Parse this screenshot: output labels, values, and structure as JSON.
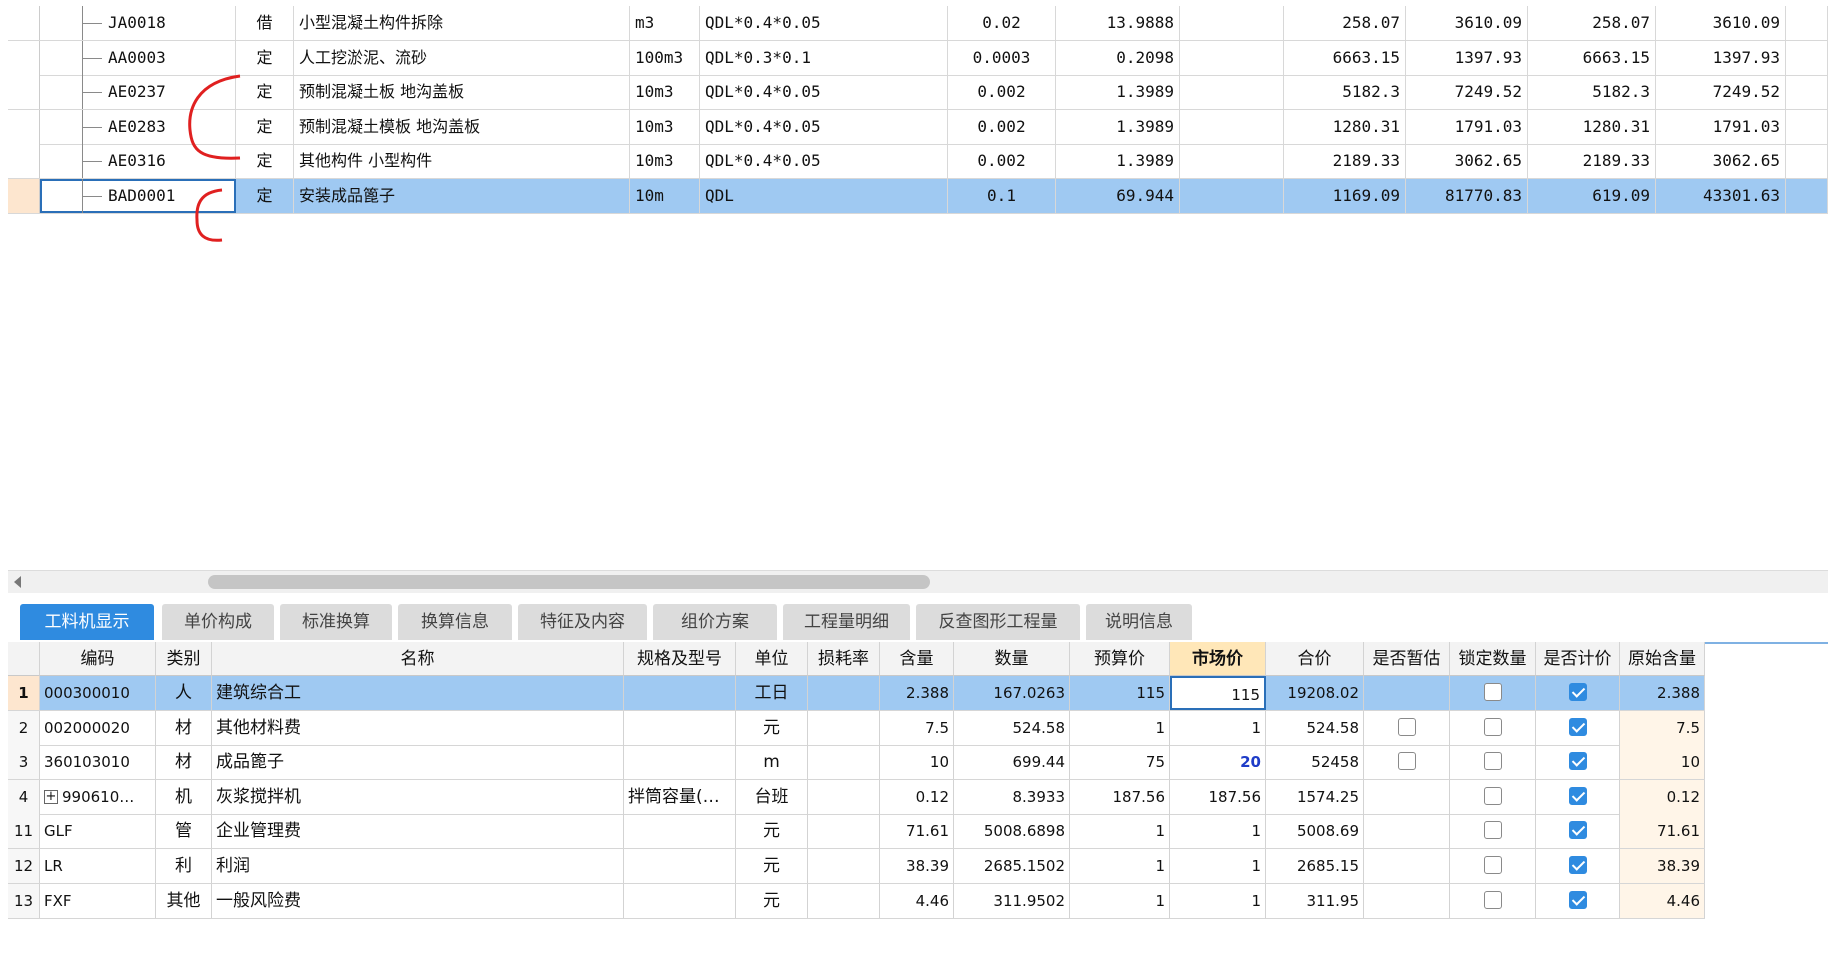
{
  "upper_rows": [
    {
      "code": "JA0018",
      "type": "借",
      "name": "小型混凝土构件拆除",
      "unit": "m3",
      "expr": "QDL*0.4*0.05",
      "coef": "0.02",
      "qty": "13.9888",
      "p1": "258.07",
      "p2": "3610.09",
      "p3": "258.07",
      "p4": "3610.09",
      "selected": false
    },
    {
      "code": "AA0003",
      "type": "定",
      "name": "人工挖淤泥、流砂",
      "unit": "100m3",
      "expr": "QDL*0.3*0.1",
      "coef": "0.0003",
      "qty": "0.2098",
      "p1": "6663.15",
      "p2": "1397.93",
      "p3": "6663.15",
      "p4": "1397.93",
      "selected": false
    },
    {
      "code": "AE0237",
      "type": "定",
      "name": "预制混凝土板 地沟盖板",
      "unit": "10m3",
      "expr": "QDL*0.4*0.05",
      "coef": "0.002",
      "qty": "1.3989",
      "p1": "5182.3",
      "p2": "7249.52",
      "p3": "5182.3",
      "p4": "7249.52",
      "selected": false
    },
    {
      "code": "AE0283",
      "type": "定",
      "name": "预制混凝土模板 地沟盖板",
      "unit": "10m3",
      "expr": "QDL*0.4*0.05",
      "coef": "0.002",
      "qty": "1.3989",
      "p1": "1280.31",
      "p2": "1791.03",
      "p3": "1280.31",
      "p4": "1791.03",
      "selected": false
    },
    {
      "code": "AE0316",
      "type": "定",
      "name": "其他构件 小型构件",
      "unit": "10m3",
      "expr": "QDL*0.4*0.05",
      "coef": "0.002",
      "qty": "1.3989",
      "p1": "2189.33",
      "p2": "3062.65",
      "p3": "2189.33",
      "p4": "3062.65",
      "selected": false
    },
    {
      "code": "BAD0001",
      "type": "定",
      "name": "安装成品篦子",
      "unit": "10m",
      "expr": "QDL",
      "coef": "0.1",
      "qty": "69.944",
      "p1": "1169.09",
      "p2": "81770.83",
      "p3": "619.09",
      "p4": "43301.63",
      "selected": true
    }
  ],
  "tabs": [
    "工料机显示",
    "单价构成",
    "标准换算",
    "换算信息",
    "特征及内容",
    "组价方案",
    "工程量明细",
    "反查图形工程量",
    "说明信息"
  ],
  "lower_headers": [
    "编码",
    "类别",
    "名称",
    "规格及型号",
    "单位",
    "损耗率",
    "含量",
    "数量",
    "预算价",
    "市场价",
    "合价",
    "是否暂估",
    "锁定数量",
    "是否计价",
    "原始含量"
  ],
  "lower_rows": [
    {
      "rn": "1",
      "code": "000300010",
      "cat": "人",
      "name": "建筑综合工",
      "spec": "",
      "unit": "工日",
      "loss": "",
      "content": "2.388",
      "qty": "167.0263",
      "budget": "115",
      "market": "115",
      "total": "19208.02",
      "est": null,
      "lock": false,
      "priced": true,
      "orig": "2.388",
      "expand": false,
      "selected": true
    },
    {
      "rn": "2",
      "code": "002000020",
      "cat": "材",
      "name": "其他材料费",
      "spec": "",
      "unit": "元",
      "loss": "",
      "content": "7.5",
      "qty": "524.58",
      "budget": "1",
      "market": "1",
      "total": "524.58",
      "est": false,
      "lock": false,
      "priced": true,
      "orig": "7.5",
      "expand": false,
      "selected": false
    },
    {
      "rn": "3",
      "code": "360103010",
      "cat": "材",
      "name": "成品篦子",
      "spec": "",
      "unit": "m",
      "loss": "",
      "content": "10",
      "qty": "699.44",
      "budget": "75",
      "market": "20",
      "total": "52458",
      "est": false,
      "lock": false,
      "priced": true,
      "orig": "10",
      "expand": false,
      "selected": false,
      "market_blue": true
    },
    {
      "rn": "4",
      "code": "990610…",
      "cat": "机",
      "name": "灰浆搅拌机",
      "spec": "拌筒容量(…",
      "unit": "台班",
      "loss": "",
      "content": "0.12",
      "qty": "8.3933",
      "budget": "187.56",
      "market": "187.56",
      "total": "1574.25",
      "est": null,
      "lock": false,
      "priced": true,
      "orig": "0.12",
      "expand": true,
      "selected": false
    },
    {
      "rn": "11",
      "code": "GLF",
      "cat": "管",
      "name": "企业管理费",
      "spec": "",
      "unit": "元",
      "loss": "",
      "content": "71.61",
      "qty": "5008.6898",
      "budget": "1",
      "market": "1",
      "total": "5008.69",
      "est": null,
      "lock": false,
      "priced": true,
      "orig": "71.61",
      "expand": false,
      "selected": false
    },
    {
      "rn": "12",
      "code": "LR",
      "cat": "利",
      "name": "利润",
      "spec": "",
      "unit": "元",
      "loss": "",
      "content": "38.39",
      "qty": "2685.1502",
      "budget": "1",
      "market": "1",
      "total": "2685.15",
      "est": null,
      "lock": false,
      "priced": true,
      "orig": "38.39",
      "expand": false,
      "selected": false
    },
    {
      "rn": "13",
      "code": "FXF",
      "cat": "其他",
      "name": "一般风险费",
      "spec": "",
      "unit": "元",
      "loss": "",
      "content": "4.46",
      "qty": "311.9502",
      "budget": "1",
      "market": "1",
      "total": "311.95",
      "est": null,
      "lock": false,
      "priced": true,
      "orig": "4.46",
      "expand": false,
      "selected": false
    }
  ],
  "colors": {
    "selection": "#9fc9f2",
    "tab_active": "#2f8be0",
    "annotation": "#e02020"
  },
  "icons": {
    "checkbox": "checkbox-icon",
    "expand": "expand-plus-icon",
    "scroll_left": "scroll-left-arrow-icon",
    "annotation": "red-bracket-annotation"
  }
}
